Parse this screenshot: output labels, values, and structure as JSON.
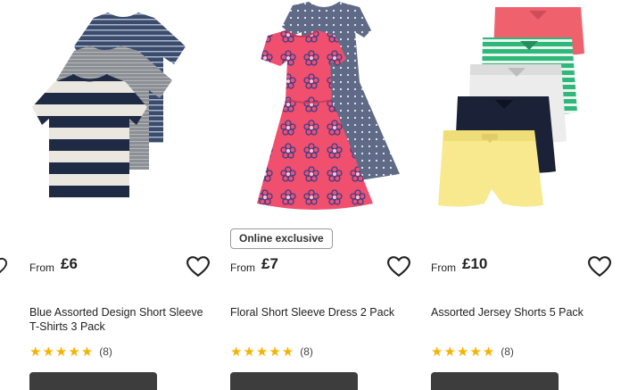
{
  "products": [
    {
      "image": "striped-tshirts-3-pack",
      "from_label": "From",
      "price": "£6",
      "title": "Blue Assorted Design Short Sleeve T-Shirts 3 Pack",
      "rating": 5,
      "rating_count": "(8)",
      "badge": ""
    },
    {
      "image": "floral-dress-2-pack",
      "from_label": "From",
      "price": "£7",
      "title": "Floral Short Sleeve Dress 2 Pack",
      "rating": 5,
      "rating_count": "(8)",
      "badge": "Online exclusive"
    },
    {
      "image": "jersey-shorts-5-pack",
      "from_label": "From",
      "price": "£10",
      "title": "Assorted Jersey Shorts 5 Pack",
      "rating": 5,
      "rating_count": "(8)",
      "badge": ""
    }
  ],
  "star_glyphs": "★★★★★",
  "colors": {
    "star": "#f5b301",
    "button": "#3d3d3d",
    "badge_border": "#9a9a9a"
  },
  "icons": [
    "heart-outline-icon",
    "star-icon"
  ]
}
